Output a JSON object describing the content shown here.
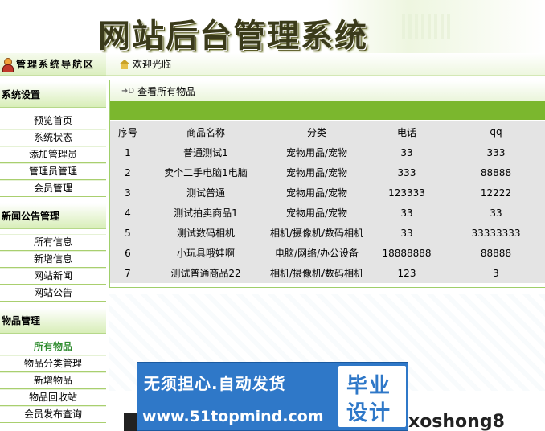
{
  "header": {
    "title": "网站后台管理系统"
  },
  "sidebar": {
    "heading": "管理系统导航区",
    "groups": [
      {
        "title": "系统设置",
        "items": [
          "预览首页",
          "系统状态",
          "添加管理员",
          "管理员管理",
          "会员管理"
        ]
      },
      {
        "title": "新闻公告管理",
        "items": [
          "所有信息",
          "新增信息",
          "网站新闻",
          "网站公告"
        ]
      },
      {
        "title": "物品管理",
        "items": [
          "所有物品",
          "物品分类管理",
          "新增物品",
          "物品回收站",
          "会员发布查询"
        ]
      }
    ],
    "active_item": "所有物品"
  },
  "welcome": {
    "text": "欢迎光临"
  },
  "panel": {
    "title": "查看所有物品"
  },
  "table": {
    "columns": [
      "序号",
      "商品名称",
      "分类",
      "电话",
      "qq"
    ],
    "rows": [
      [
        "1",
        "普通测试1",
        "宠物用品/宠物",
        "33",
        "333"
      ],
      [
        "2",
        "卖个二手电脑1电脑",
        "宠物用品/宠物",
        "333",
        "88888"
      ],
      [
        "3",
        "测试普通",
        "宠物用品/宠物",
        "123333",
        "12222"
      ],
      [
        "4",
        "测试拍卖商品1",
        "宠物用品/宠物",
        "33",
        "33"
      ],
      [
        "5",
        "测试数码相机",
        "相机/摄像机/数码相机",
        "33",
        "33333333"
      ],
      [
        "6",
        "小玩具哦娃啊",
        "电脑/网络/办公设备",
        "18888888",
        "88888"
      ],
      [
        "7",
        "测试普通商品22",
        "相机/摄像机/数码相机",
        "123",
        "3"
      ]
    ]
  },
  "watermark": {
    "slogan": "无须担心.自动发货",
    "url": "www.51topmind.com",
    "tag_line1": "毕业",
    "tag_line2": "设计",
    "trail": "xoshong8"
  },
  "colors": {
    "accent_green": "#7bb72e",
    "table_bg": "#e4e4e4",
    "active_link": "#2f8c2f",
    "watermark_blue": "#2f78c8"
  }
}
